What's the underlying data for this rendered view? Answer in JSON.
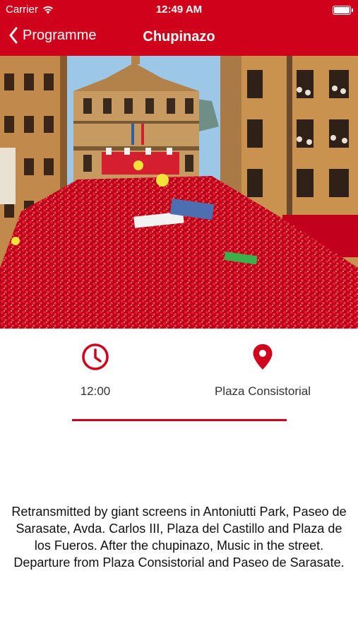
{
  "status_bar": {
    "carrier": "Carrier",
    "time": "12:49 AM"
  },
  "nav": {
    "back_label": "Programme",
    "title": "Chupinazo"
  },
  "event": {
    "time": "12:00",
    "location": "Plaza Consistorial",
    "description": "Retransmitted by giant screens in Antoniutti Park, Paseo de Sarasate, Avda. Carlos III, Plaza del Castillo and Plaza de los Fueros. After the chupinazo, Music in the street. Departure from Plaza Consistorial and Paseo de Sarasate."
  },
  "colors": {
    "accent": "#d0021b",
    "text": "#111111"
  },
  "icons": {
    "back": "chevron-left-icon",
    "time": "clock-icon",
    "location": "map-pin-icon",
    "signal": "wifi-icon",
    "battery": "battery-icon"
  }
}
